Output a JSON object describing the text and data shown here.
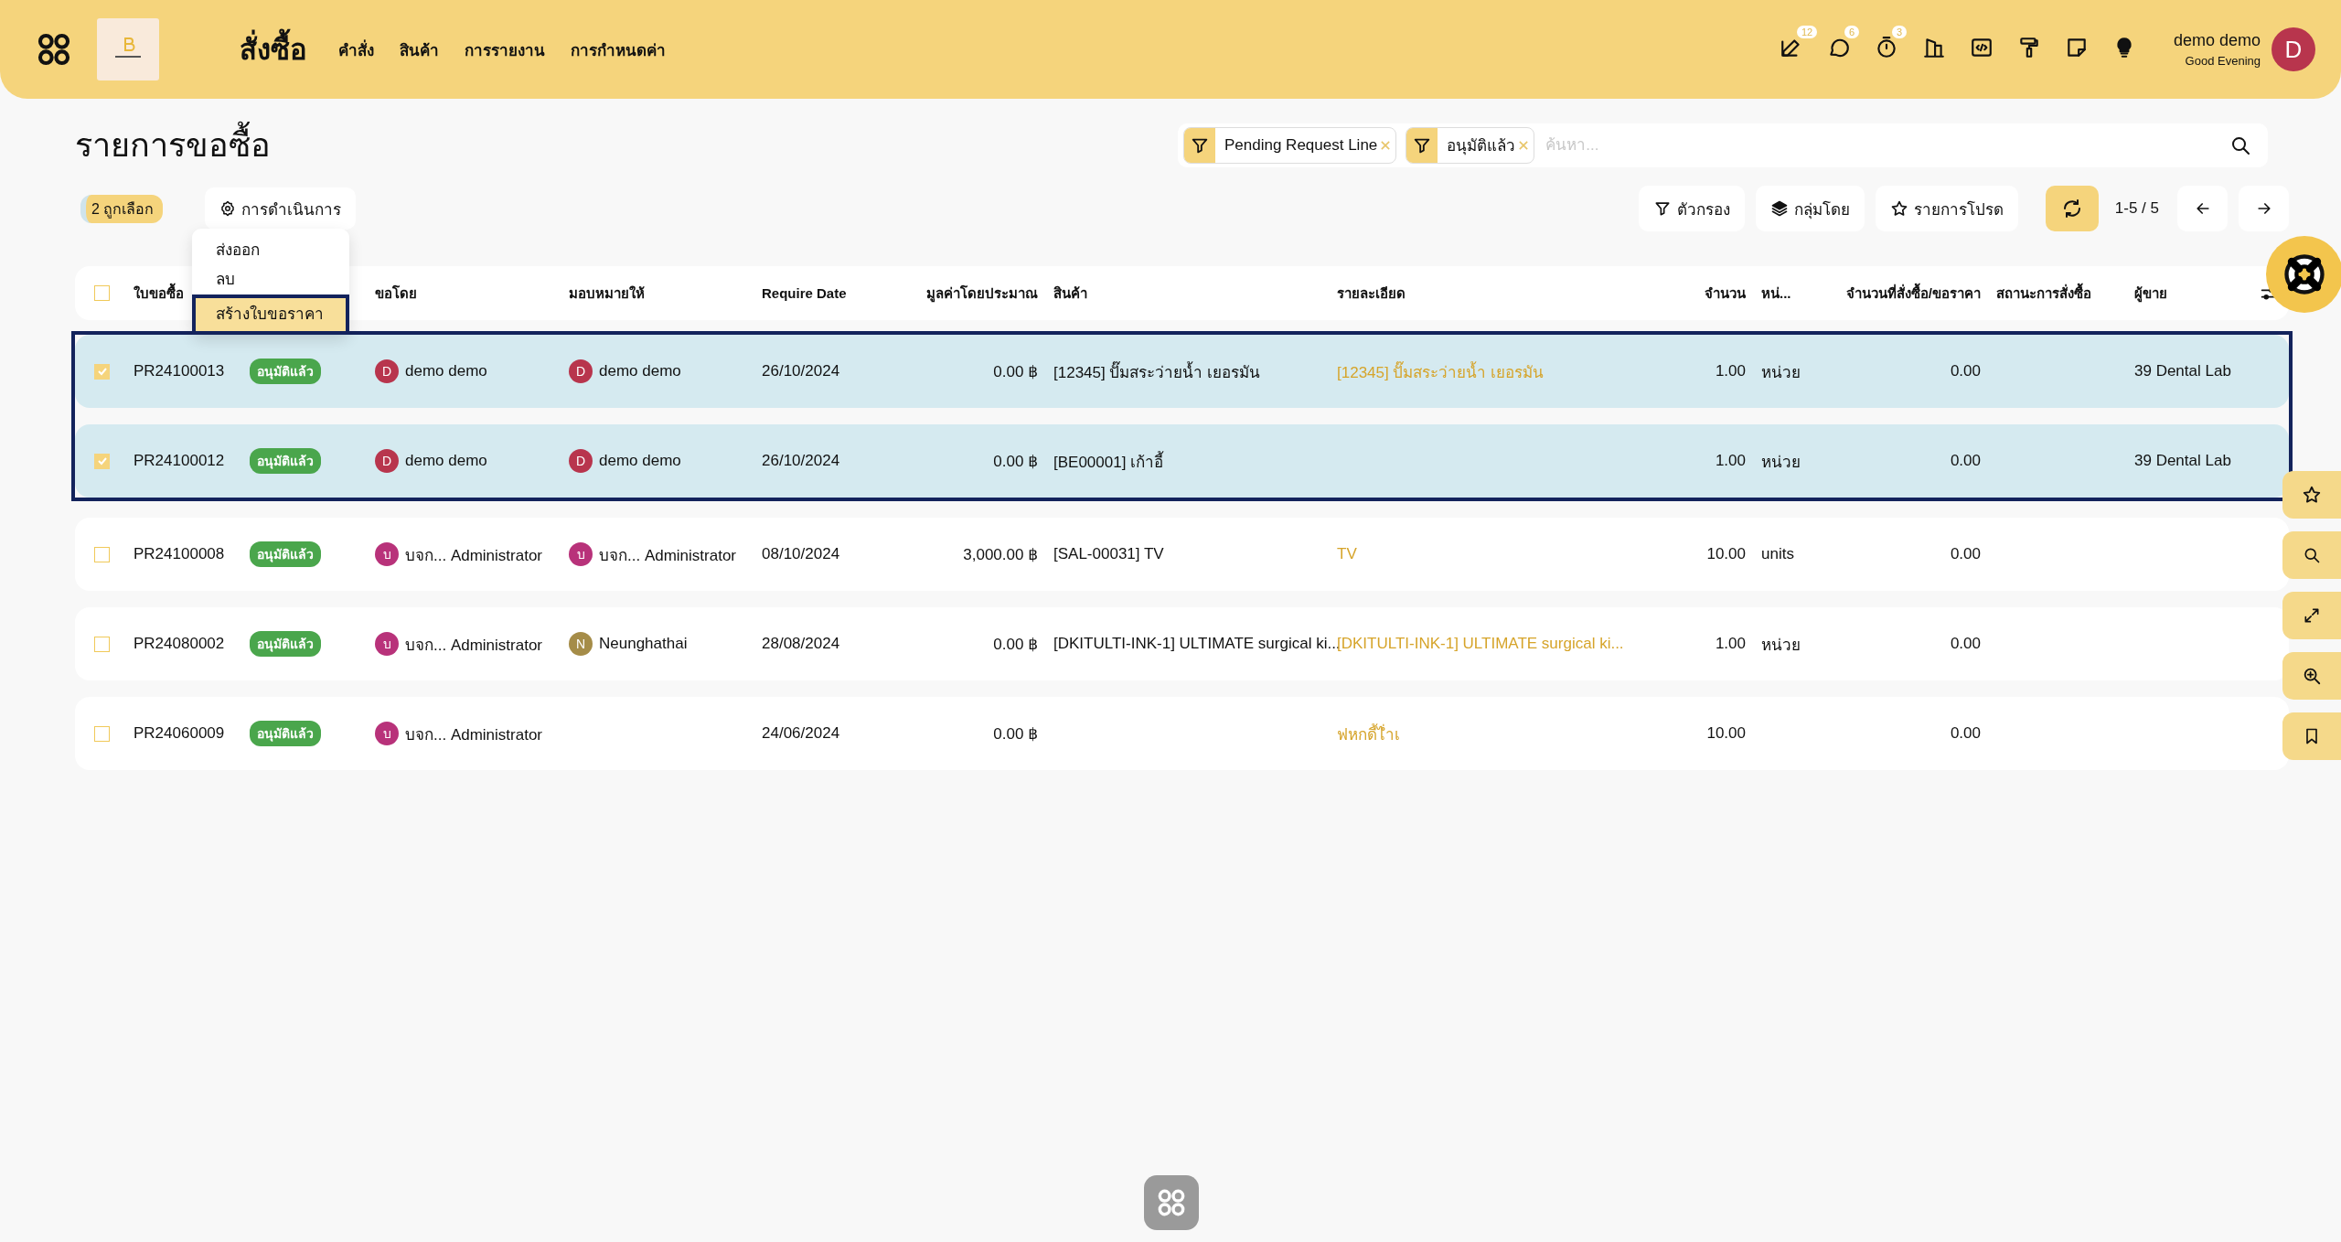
{
  "header": {
    "app_title": "สั่งซื้อ",
    "nav": [
      "คำสั่ง",
      "สินค้า",
      "การรายงาน",
      "การกำหนดค่า"
    ],
    "icon_badges": [
      "12",
      "6",
      "3"
    ],
    "user": {
      "name": "demo demo",
      "greeting": "Good Evening",
      "initial": "D"
    }
  },
  "page_title": "รายการขอซื้อ",
  "filters": [
    {
      "label": "Pending Request Line"
    },
    {
      "label": "อนุมัติแล้ว"
    }
  ],
  "search": {
    "placeholder": "ค้นหา..."
  },
  "selection": {
    "count_label": "2 ถูกเลือก",
    "actions_button": "การดำเนินการ"
  },
  "actions_menu": [
    {
      "label": "ส่งออก",
      "selected": false
    },
    {
      "label": "ลบ",
      "selected": false
    },
    {
      "label": "สร้างใบขอราคา",
      "selected": true
    }
  ],
  "toolbar": {
    "filter": "ตัวกรอง",
    "group_by": "กลุ่มโดย",
    "favorites": "รายการโปรด",
    "pagination": "1-5 / 5"
  },
  "table": {
    "all_selected": false,
    "columns": [
      "ใบขอซื้อ",
      "",
      "ขอโดย",
      "มอบหมายให้",
      "Require Date",
      "มูลค่าโดยประมาณ",
      "สินค้า",
      "รายละเอียด",
      "จำนวน",
      "หน่...",
      "จำนวนที่สั่งซื้อ/ขอราคา",
      "สถานะการสั่งซื้อ",
      "ผู้ขาย"
    ],
    "rows": [
      {
        "checked": true,
        "id": "PR24100013",
        "status": "อนุมัติแล้ว",
        "requested_by": {
          "initial": "D",
          "name": "demo demo",
          "color": "#b8354d"
        },
        "assigned_to": {
          "initial": "D",
          "name": "demo demo",
          "color": "#b8354d"
        },
        "date": "26/10/2024",
        "value": "0.00 ฿",
        "product": "[12345] ปั๊มสระว่ายน้ำ เยอรมัน",
        "description": "[12345] ปั๊มสระว่ายน้ำ เยอรมัน",
        "qty": "1.00",
        "unit": "หน่วย",
        "ordered_qty": "0.00",
        "vendor": "39 Dental Lab"
      },
      {
        "checked": true,
        "id": "PR24100012",
        "status": "อนุมัติแล้ว",
        "requested_by": {
          "initial": "D",
          "name": "demo demo",
          "color": "#b8354d"
        },
        "assigned_to": {
          "initial": "D",
          "name": "demo demo",
          "color": "#b8354d"
        },
        "date": "26/10/2024",
        "value": "0.00 ฿",
        "product": "[BE00001] เก้าอี้",
        "qty": "1.00",
        "unit": "หน่วย",
        "ordered_qty": "0.00",
        "vendor": "39 Dental Lab"
      },
      {
        "checked": false,
        "id": "PR24100008",
        "status": "อนุมัติแล้ว",
        "requested_by": {
          "initial": "บ",
          "name": "บจก... Administrator",
          "color": "#b8327a"
        },
        "assigned_to": {
          "initial": "บ",
          "name": "บจก... Administrator",
          "color": "#b8327a"
        },
        "date": "08/10/2024",
        "value": "3,000.00 ฿",
        "product": "[SAL-00031] TV",
        "description": "TV",
        "qty": "10.00",
        "unit": "units",
        "ordered_qty": "0.00"
      },
      {
        "checked": false,
        "id": "PR24080002",
        "status": "อนุมัติแล้ว",
        "requested_by": {
          "initial": "บ",
          "name": "บจก... Administrator",
          "color": "#b8327a"
        },
        "assigned_to": {
          "initial": "N",
          "name": "Neunghathai",
          "color": "#a58c48"
        },
        "date": "28/08/2024",
        "value": "0.00 ฿",
        "product": "[DKITULTI-INK-1] ULTIMATE surgical ki...",
        "description": "[DKITULTI-INK-1] ULTIMATE surgical ki...",
        "qty": "1.00",
        "unit": "หน่วย",
        "ordered_qty": "0.00"
      },
      {
        "checked": false,
        "id": "PR24060009",
        "status": "อนุมัติแล้ว",
        "requested_by": {
          "initial": "บ",
          "name": "บจก... Administrator",
          "color": "#b8327a"
        },
        "date": "24/06/2024",
        "value": "0.00 ฿",
        "description": "ฟหกดี้ไ่ำเ",
        "qty": "10.00",
        "ordered_qty": "0.00"
      }
    ]
  }
}
